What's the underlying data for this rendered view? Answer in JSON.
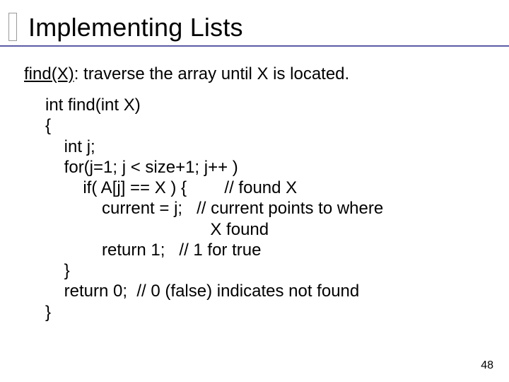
{
  "title": "Implementing Lists",
  "description_func": "find(X)",
  "description_text": ": traverse the array until X is located.",
  "code": {
    "l1": "int find(int X)",
    "l2": "{",
    "l3": "    int j;",
    "l4": "    for(j=1; j < size+1; j++ )",
    "l5": "        if( A[j] == X ) {        // found X",
    "l6": "            current = j;   // current points to where",
    "l7": "                                   X found",
    "l8": "            return 1;   // 1 for true",
    "l9": "    }",
    "l10": "    return 0;  // 0 (false) indicates not found",
    "l11": "}"
  },
  "page_number": "48"
}
